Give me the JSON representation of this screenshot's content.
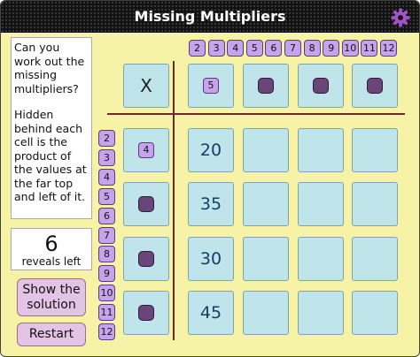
{
  "app": {
    "title": "Missing Multipliers",
    "settings_icon": "gear-icon"
  },
  "instructions": {
    "question": "Can you work out the missing multipliers?",
    "explanation": "Hidden behind each cell is the product of the values at the far top and left of it."
  },
  "reveals": {
    "count": "6",
    "label": "reveals left"
  },
  "buttons": {
    "show_solution": "Show the solution",
    "restart": "Restart"
  },
  "number_options": [
    "2",
    "3",
    "4",
    "5",
    "6",
    "7",
    "8",
    "9",
    "10",
    "11",
    "12"
  ],
  "grid": {
    "corner": "X",
    "top_headers": [
      "5",
      "",
      "",
      ""
    ],
    "left_headers": [
      "4",
      "",
      "",
      ""
    ],
    "cells": [
      [
        "20",
        "",
        "",
        ""
      ],
      [
        "35",
        "",
        "",
        ""
      ],
      [
        "30",
        "",
        "",
        ""
      ],
      [
        "45",
        "",
        "",
        ""
      ]
    ]
  },
  "colors": {
    "background": "#f7f3a6",
    "tile": "#bfe4ea",
    "chip": "#c7a3ee",
    "hidden_marker": "#6a4579",
    "button": "#e4c4e6",
    "grid_line": "#6b2b2b"
  }
}
